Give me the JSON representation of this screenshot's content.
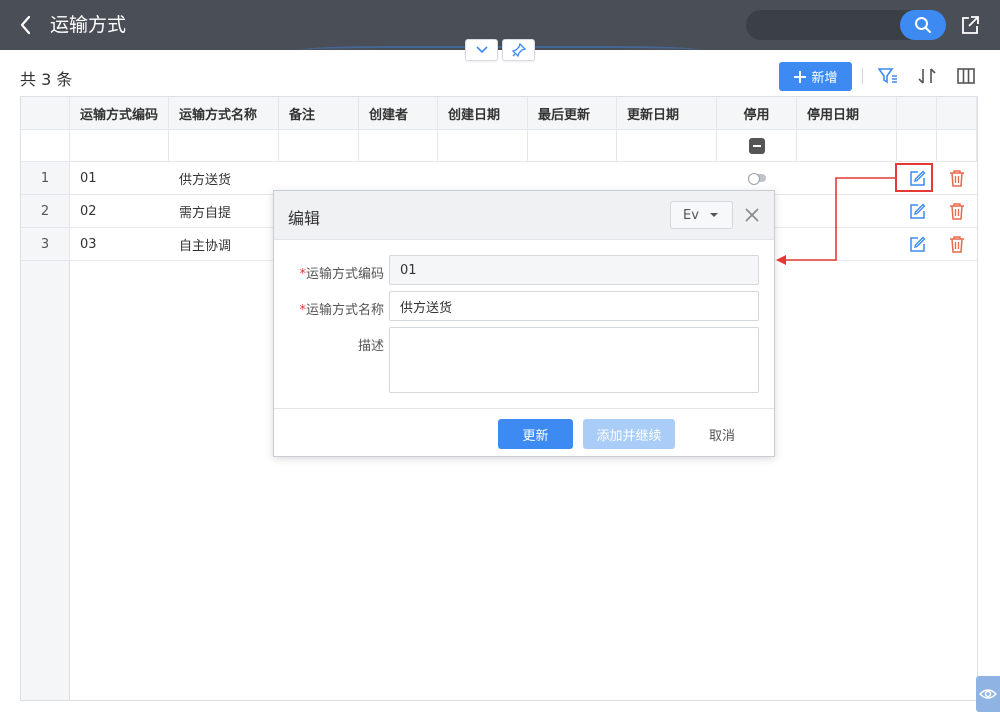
{
  "header": {
    "title": "运输方式",
    "back_icon": "chevron-left-icon",
    "search_icon": "search-icon",
    "share_icon": "share-icon",
    "search": {
      "value": "",
      "placeholder": ""
    },
    "colors": {
      "bar": "#4a4f57",
      "accent": "#3d8bf2"
    }
  },
  "toolbar": {
    "count_text": "共 3 条",
    "add_label": "新增",
    "icons": [
      "filter-icon",
      "sort-icon",
      "columns-icon"
    ]
  },
  "grid": {
    "columns": [
      "运输方式编码",
      "运输方式名称",
      "备注",
      "创建者",
      "创建日期",
      "最后更新",
      "更新日期",
      "停用",
      "停用日期"
    ],
    "rows": [
      {
        "num": "1",
        "code": "01",
        "name": "供方送货"
      },
      {
        "num": "2",
        "code": "02",
        "name": "需方自提"
      },
      {
        "num": "3",
        "code": "03",
        "name": "自主协调"
      }
    ],
    "row_actions": [
      "edit-icon",
      "trash-icon"
    ]
  },
  "dialog": {
    "title": "编辑",
    "language": "Ev",
    "fields": [
      {
        "label": "运输方式编码",
        "required": true,
        "value": "01"
      },
      {
        "label": "运输方式名称",
        "required": true,
        "value": "供方送货"
      },
      {
        "label": "描述",
        "required": false,
        "value": ""
      }
    ],
    "buttons": {
      "update": "更新",
      "add_continue": "添加并继续",
      "cancel": "取消"
    },
    "colors": {
      "highlight": "#e53935"
    }
  }
}
